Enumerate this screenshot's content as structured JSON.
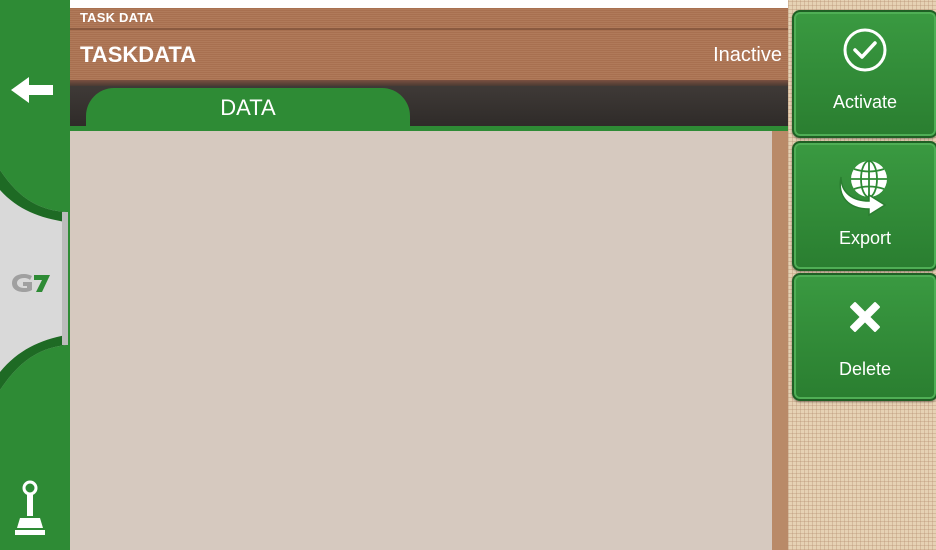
{
  "header": {
    "subtitle": "TASK DATA",
    "title": "TASKDATA",
    "status": "Inactive"
  },
  "tabs": [
    {
      "label": "DATA",
      "active": true
    }
  ],
  "actions": {
    "activate_label": "Activate",
    "export_label": "Export",
    "delete_label": "Delete"
  },
  "sidebar": {
    "logo_text": "G7"
  },
  "colors": {
    "green": "#2e8b35",
    "header_brown": "#a97253",
    "content_bg": "#d6c9bf",
    "tabbar_dark": "#3a3532"
  }
}
